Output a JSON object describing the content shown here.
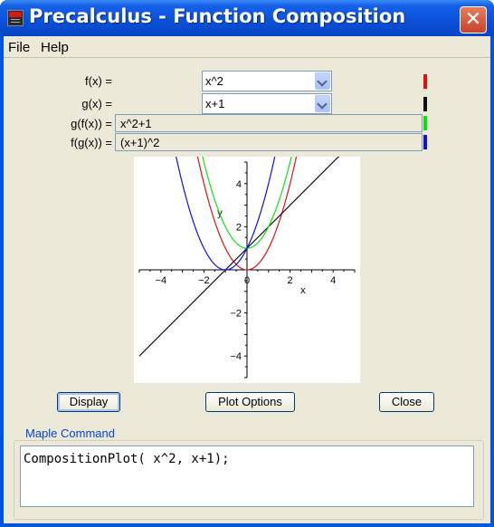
{
  "window": {
    "title": "Precalculus - Function Composition",
    "close_glyph": "✕"
  },
  "menu": [
    "File",
    "Help"
  ],
  "rows": {
    "f": {
      "label": "f(x) =",
      "value": "x^2",
      "color": "#e01010"
    },
    "g": {
      "label": "g(x) =",
      "value": "x+1",
      "color": "#101010"
    },
    "gf": {
      "label": "g(f(x)) =",
      "value": "x^2+1",
      "color": "#10e010"
    },
    "fg": {
      "label": "f(g(x)) =",
      "value": "(x+1)^2",
      "color": "#1010e0"
    }
  },
  "buttons": {
    "display": "Display",
    "plot_options": "Plot Options",
    "close": "Close"
  },
  "maple": {
    "title": "Maple Command",
    "command": "CompositionPlot( x^2, x+1);"
  },
  "chart_data": {
    "type": "line",
    "xlabel": "x",
    "ylabel": "y",
    "xlim": [
      -5,
      5
    ],
    "ylim": [
      -5,
      5
    ],
    "xticks": [
      -4,
      -2,
      0,
      2,
      4
    ],
    "yticks": [
      -4,
      -2,
      2,
      4
    ],
    "series": [
      {
        "expr": "x^2",
        "color": "#e01010"
      },
      {
        "expr": "x+1",
        "color": "#101010"
      },
      {
        "expr": "x^2+1",
        "color": "#10e010"
      },
      {
        "expr": "(x+1)^2",
        "color": "#1010e0"
      }
    ]
  }
}
